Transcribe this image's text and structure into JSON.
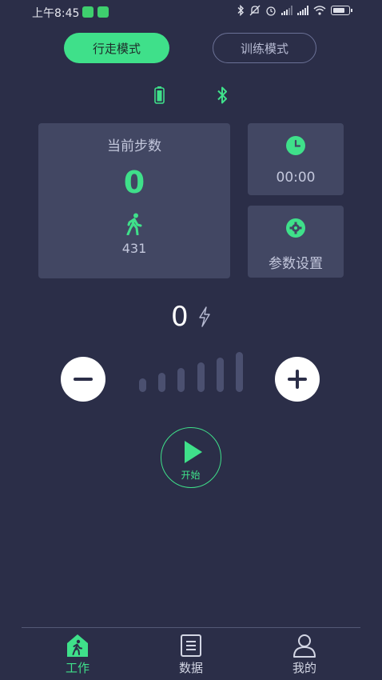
{
  "status_bar": {
    "time": "上午8:45",
    "icons": [
      "wechat-icon",
      "app-notification-icon",
      "bluetooth-icon",
      "mute-icon",
      "alarm-icon",
      "signal-icon",
      "signal-icon",
      "wifi-icon",
      "battery-icon"
    ]
  },
  "mode_toggle": {
    "walk_label": "行走模式",
    "train_label": "训练模式",
    "selected": "行走模式"
  },
  "device_status": {
    "icons": [
      "battery-icon",
      "bluetooth-icon"
    ]
  },
  "steps_card": {
    "title": "当前步数",
    "count": "0",
    "sub_value": "431",
    "icon": "walker-icon"
  },
  "timer_card": {
    "value": "00:00",
    "icon": "clock-icon"
  },
  "settings_card": {
    "label": "参数设置",
    "icon": "gear-icon"
  },
  "intensity": {
    "value": "0",
    "level": 0,
    "max_level": 6,
    "icon": "bolt-icon"
  },
  "start_button": {
    "label": "开始",
    "icon": "play-icon"
  },
  "bottom_nav": {
    "items": [
      {
        "label": "工作",
        "icon": "home-walker-icon",
        "active": true
      },
      {
        "label": "数据",
        "icon": "list-icon",
        "active": false
      },
      {
        "label": "我的",
        "icon": "user-icon",
        "active": false
      }
    ]
  },
  "colors": {
    "background": "#2b2e48",
    "card": "#424763",
    "accent": "#3fe08a",
    "muted_text": "#c3c7dc",
    "inactive_bar": "#4b5070"
  }
}
